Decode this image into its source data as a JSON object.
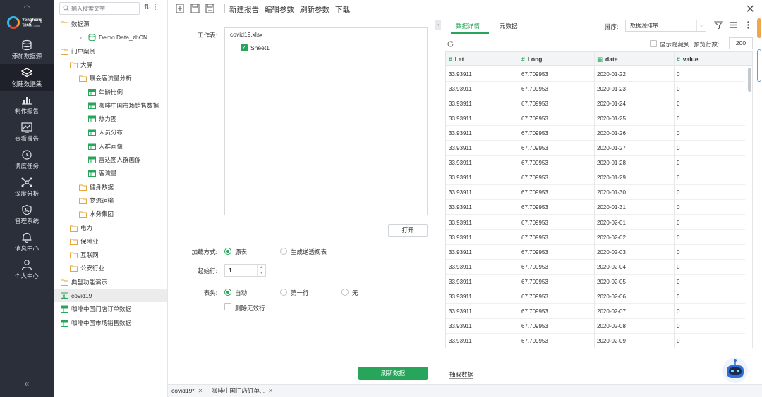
{
  "nav": {
    "brand": "Yonghong Tech",
    "brand_sub": "Talk with Data",
    "items": [
      {
        "label": "添加数据源",
        "icon": "database-icon"
      },
      {
        "label": "创建数据集",
        "icon": "layers-icon"
      },
      {
        "label": "制作报告",
        "icon": "bar-chart-icon"
      },
      {
        "label": "查看报告",
        "icon": "line-chart-icon"
      },
      {
        "label": "调度任务",
        "icon": "clock-icon"
      },
      {
        "label": "深度分析",
        "icon": "network-icon"
      },
      {
        "label": "管理系统",
        "icon": "shield-icon"
      },
      {
        "label": "消息中心",
        "icon": "bell-icon"
      },
      {
        "label": "个人中心",
        "icon": "user-icon"
      }
    ],
    "active_index": 1,
    "collapse_glyph": "«"
  },
  "tree": {
    "search_placeholder": "输入搜索文字",
    "tools_glyph": "⇅ ⋮",
    "nodes": [
      {
        "label": "数据源",
        "type": "folder",
        "indent": 0,
        "caret": ""
      },
      {
        "label": "Demo Data_zhCN",
        "type": "db",
        "indent": 1,
        "caret": "›"
      },
      {
        "label": "门户案例",
        "type": "folder",
        "indent": 0,
        "caret": ""
      },
      {
        "label": "大屏",
        "type": "folder",
        "indent": 1,
        "caret": ""
      },
      {
        "label": "展会客流量分析",
        "type": "folder",
        "indent": 2,
        "caret": ""
      },
      {
        "label": "年龄比例",
        "type": "table",
        "indent": 3,
        "caret": ""
      },
      {
        "label": "咖啡中国市场销售数据",
        "type": "table",
        "indent": 3,
        "caret": ""
      },
      {
        "label": "热力图",
        "type": "table",
        "indent": 3,
        "caret": ""
      },
      {
        "label": "人员分布",
        "type": "table",
        "indent": 3,
        "caret": ""
      },
      {
        "label": "人群画像",
        "type": "table",
        "indent": 3,
        "caret": ""
      },
      {
        "label": "雷达图人群画像",
        "type": "table",
        "indent": 3,
        "caret": ""
      },
      {
        "label": "客流量",
        "type": "table",
        "indent": 3,
        "caret": ""
      },
      {
        "label": "健身数据",
        "type": "folder",
        "indent": 2,
        "caret": ""
      },
      {
        "label": "物流运输",
        "type": "folder",
        "indent": 2,
        "caret": ""
      },
      {
        "label": "水务集团",
        "type": "folder",
        "indent": 2,
        "caret": ""
      },
      {
        "label": "电力",
        "type": "folder",
        "indent": 1,
        "caret": ""
      },
      {
        "label": "保险业",
        "type": "folder",
        "indent": 1,
        "caret": ""
      },
      {
        "label": "互联网",
        "type": "folder",
        "indent": 1,
        "caret": ""
      },
      {
        "label": "公安行业",
        "type": "folder",
        "indent": 1,
        "caret": ""
      },
      {
        "label": "典型功能演示",
        "type": "folder",
        "indent": 0,
        "caret": ""
      },
      {
        "label": "covid19",
        "type": "excel",
        "indent": 0,
        "caret": "",
        "selected": true
      },
      {
        "label": "咖啡中国门店订单数据",
        "type": "table",
        "indent": 0,
        "caret": ""
      },
      {
        "label": "咖啡中国市场销售数据",
        "type": "table",
        "indent": 0,
        "caret": ""
      }
    ]
  },
  "toolbar": {
    "buttons": [
      "新建报告",
      "编辑参数",
      "刷新参数",
      "下载"
    ],
    "close_glyph": "✕"
  },
  "config": {
    "worksheet_label": "工作表:",
    "file_name": "covid19.xlsx",
    "sheet_name": "Sheet1",
    "sheet_checked": true,
    "open_button": "打开",
    "load_mode_label": "加载方式:",
    "load_mode_options": [
      "源表",
      "生成逆透视表"
    ],
    "load_mode_selected": 0,
    "start_row_label": "起始行:",
    "start_row_value": "1",
    "header_label": "表头:",
    "header_options": [
      "自动",
      "第一行",
      "无"
    ],
    "header_selected": 0,
    "delete_invalid_label": "删除无效行",
    "refresh_button": "刷新数据"
  },
  "bottom_tabs": [
    {
      "label": "covid19*",
      "close": "✕"
    },
    {
      "label": "咖啡中国门店订单...",
      "close": "✕"
    }
  ],
  "datapanel": {
    "tabs": [
      "数据详情",
      "元数据"
    ],
    "active_tab": 0,
    "sort_label": "排序:",
    "sort_value": "数据源排序",
    "show_hidden_label": "显示隐藏列",
    "preview_rows_label": "预览行数:",
    "preview_rows_value": "200",
    "columns": [
      {
        "name": "Lat",
        "type_glyph": "#"
      },
      {
        "name": "Long",
        "type_glyph": "#"
      },
      {
        "name": "date",
        "type_glyph": "▦"
      },
      {
        "name": "value",
        "type_glyph": "#"
      }
    ],
    "rows": [
      [
        "33.93911",
        "67.709953",
        "2020-01-22",
        "0"
      ],
      [
        "33.93911",
        "67.709953",
        "2020-01-23",
        "0"
      ],
      [
        "33.93911",
        "67.709953",
        "2020-01-24",
        "0"
      ],
      [
        "33.93911",
        "67.709953",
        "2020-01-25",
        "0"
      ],
      [
        "33.93911",
        "67.709953",
        "2020-01-26",
        "0"
      ],
      [
        "33.93911",
        "67.709953",
        "2020-01-27",
        "0"
      ],
      [
        "33.93911",
        "67.709953",
        "2020-01-28",
        "0"
      ],
      [
        "33.93911",
        "67.709953",
        "2020-01-29",
        "0"
      ],
      [
        "33.93911",
        "67.709953",
        "2020-01-30",
        "0"
      ],
      [
        "33.93911",
        "67.709953",
        "2020-01-31",
        "0"
      ],
      [
        "33.93911",
        "67.709953",
        "2020-02-01",
        "0"
      ],
      [
        "33.93911",
        "67.709953",
        "2020-02-02",
        "0"
      ],
      [
        "33.93911",
        "67.709953",
        "2020-02-03",
        "0"
      ],
      [
        "33.93911",
        "67.709953",
        "2020-02-04",
        "0"
      ],
      [
        "33.93911",
        "67.709953",
        "2020-02-05",
        "0"
      ],
      [
        "33.93911",
        "67.709953",
        "2020-02-06",
        "0"
      ],
      [
        "33.93911",
        "67.709953",
        "2020-02-07",
        "0"
      ],
      [
        "33.93911",
        "67.709953",
        "2020-02-08",
        "0"
      ],
      [
        "33.93911",
        "67.709953",
        "2020-02-09",
        "0"
      ]
    ],
    "extract_label": "抽取数据"
  },
  "colors": {
    "accent": "#27a55a",
    "nav_bg": "#2b2f3a",
    "scroll_accent": "#f0a64a"
  }
}
